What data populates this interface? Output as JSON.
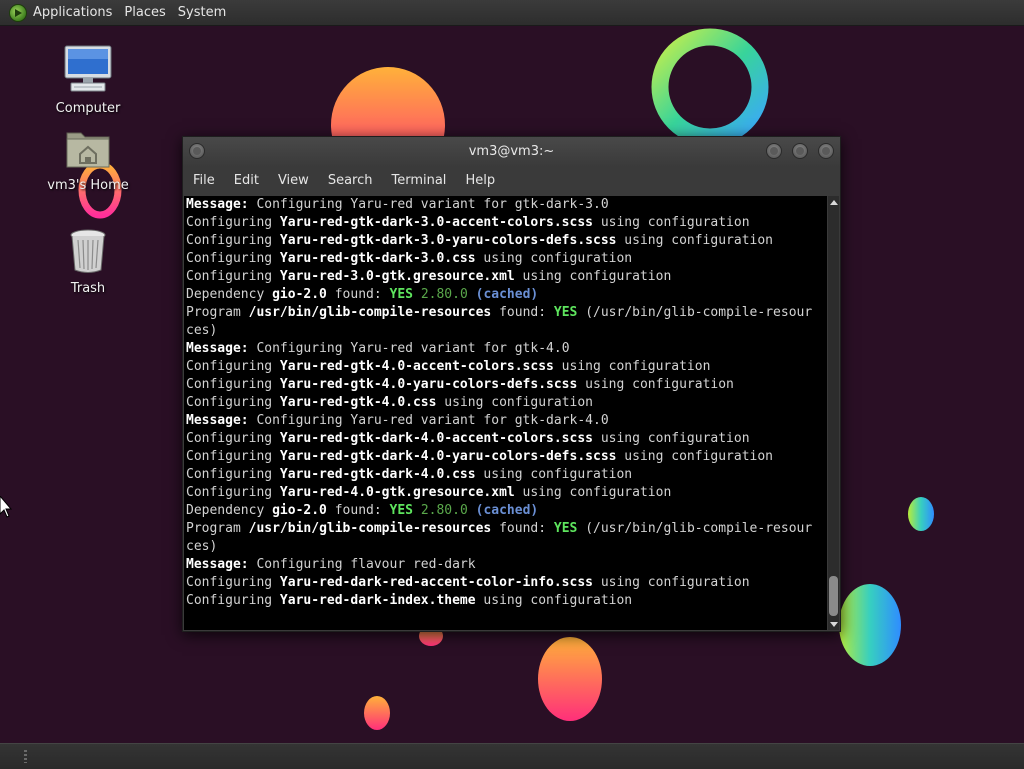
{
  "top_panel": {
    "menus": [
      "Applications",
      "Places",
      "System"
    ]
  },
  "desktop": {
    "icons": [
      {
        "label": "Computer",
        "icon": "computer-icon"
      },
      {
        "label": "vm3's Home",
        "icon": "home-folder-icon"
      },
      {
        "label": "Trash",
        "icon": "trash-icon"
      }
    ]
  },
  "terminal": {
    "title": "vm3@vm3:~",
    "menu": [
      "File",
      "Edit",
      "View",
      "Search",
      "Terminal",
      "Help"
    ],
    "lines": [
      [
        {
          "t": "Message:",
          "s": "b"
        },
        {
          "t": " Configuring Yaru-red variant for gtk-dark-3.0"
        }
      ],
      [
        {
          "t": "Configuring "
        },
        {
          "t": "Yaru-red-gtk-dark-3.0-accent-colors.scss",
          "s": "b"
        },
        {
          "t": " using configuration"
        }
      ],
      [
        {
          "t": "Configuring "
        },
        {
          "t": "Yaru-red-gtk-dark-3.0-yaru-colors-defs.scss",
          "s": "b"
        },
        {
          "t": " using configuration"
        }
      ],
      [
        {
          "t": "Configuring "
        },
        {
          "t": "Yaru-red-gtk-dark-3.0.css",
          "s": "b"
        },
        {
          "t": " using configuration"
        }
      ],
      [
        {
          "t": "Configuring "
        },
        {
          "t": "Yaru-red-3.0-gtk.gresource.xml",
          "s": "b"
        },
        {
          "t": " using configuration"
        }
      ],
      [
        {
          "t": "Dependency "
        },
        {
          "t": "gio-2.0",
          "s": "b"
        },
        {
          "t": " found: "
        },
        {
          "t": "YES",
          "s": "g"
        },
        {
          "t": " "
        },
        {
          "t": "2.80.0",
          "s": "v"
        },
        {
          "t": " "
        },
        {
          "t": "(cached)",
          "s": "c"
        }
      ],
      [
        {
          "t": "Program "
        },
        {
          "t": "/usr/bin/glib-compile-resources",
          "s": "b"
        },
        {
          "t": " found: "
        },
        {
          "t": "YES",
          "s": "g"
        },
        {
          "t": " (/usr/bin/glib-compile-resour"
        }
      ],
      [
        {
          "t": "ces)"
        }
      ],
      [
        {
          "t": "Message:",
          "s": "b"
        },
        {
          "t": " Configuring Yaru-red variant for gtk-4.0"
        }
      ],
      [
        {
          "t": "Configuring "
        },
        {
          "t": "Yaru-red-gtk-4.0-accent-colors.scss",
          "s": "b"
        },
        {
          "t": " using configuration"
        }
      ],
      [
        {
          "t": "Configuring "
        },
        {
          "t": "Yaru-red-gtk-4.0-yaru-colors-defs.scss",
          "s": "b"
        },
        {
          "t": " using configuration"
        }
      ],
      [
        {
          "t": "Configuring "
        },
        {
          "t": "Yaru-red-gtk-4.0.css",
          "s": "b"
        },
        {
          "t": " using configuration"
        }
      ],
      [
        {
          "t": "Message:",
          "s": "b"
        },
        {
          "t": " Configuring Yaru-red variant for gtk-dark-4.0"
        }
      ],
      [
        {
          "t": "Configuring "
        },
        {
          "t": "Yaru-red-gtk-dark-4.0-accent-colors.scss",
          "s": "b"
        },
        {
          "t": " using configuration"
        }
      ],
      [
        {
          "t": "Configuring "
        },
        {
          "t": "Yaru-red-gtk-dark-4.0-yaru-colors-defs.scss",
          "s": "b"
        },
        {
          "t": " using configuration"
        }
      ],
      [
        {
          "t": "Configuring "
        },
        {
          "t": "Yaru-red-gtk-dark-4.0.css",
          "s": "b"
        },
        {
          "t": " using configuration"
        }
      ],
      [
        {
          "t": "Configuring "
        },
        {
          "t": "Yaru-red-4.0-gtk.gresource.xml",
          "s": "b"
        },
        {
          "t": " using configuration"
        }
      ],
      [
        {
          "t": "Dependency "
        },
        {
          "t": "gio-2.0",
          "s": "b"
        },
        {
          "t": " found: "
        },
        {
          "t": "YES",
          "s": "g"
        },
        {
          "t": " "
        },
        {
          "t": "2.80.0",
          "s": "v"
        },
        {
          "t": " "
        },
        {
          "t": "(cached)",
          "s": "c"
        }
      ],
      [
        {
          "t": "Program "
        },
        {
          "t": "/usr/bin/glib-compile-resources",
          "s": "b"
        },
        {
          "t": " found: "
        },
        {
          "t": "YES",
          "s": "g"
        },
        {
          "t": " (/usr/bin/glib-compile-resour"
        }
      ],
      [
        {
          "t": "ces)"
        }
      ],
      [
        {
          "t": "Message:",
          "s": "b"
        },
        {
          "t": " Configuring flavour red-dark"
        }
      ],
      [
        {
          "t": "Configuring "
        },
        {
          "t": "Yaru-red-dark-red-accent-color-info.scss",
          "s": "b"
        },
        {
          "t": " using configuration"
        }
      ],
      [
        {
          "t": "Configuring "
        },
        {
          "t": "Yaru-red-dark-index.theme",
          "s": "b"
        },
        {
          "t": " using configuration"
        }
      ]
    ]
  },
  "colors": {
    "desktop_bg": "#2a0f25",
    "panel_bg": "#2f2f2f",
    "terminal_bg": "#000000",
    "terminal_text": "#d3d3d3",
    "found_yes": "#5ee55e",
    "version": "#5aa84b",
    "cached": "#6a8fd4"
  }
}
